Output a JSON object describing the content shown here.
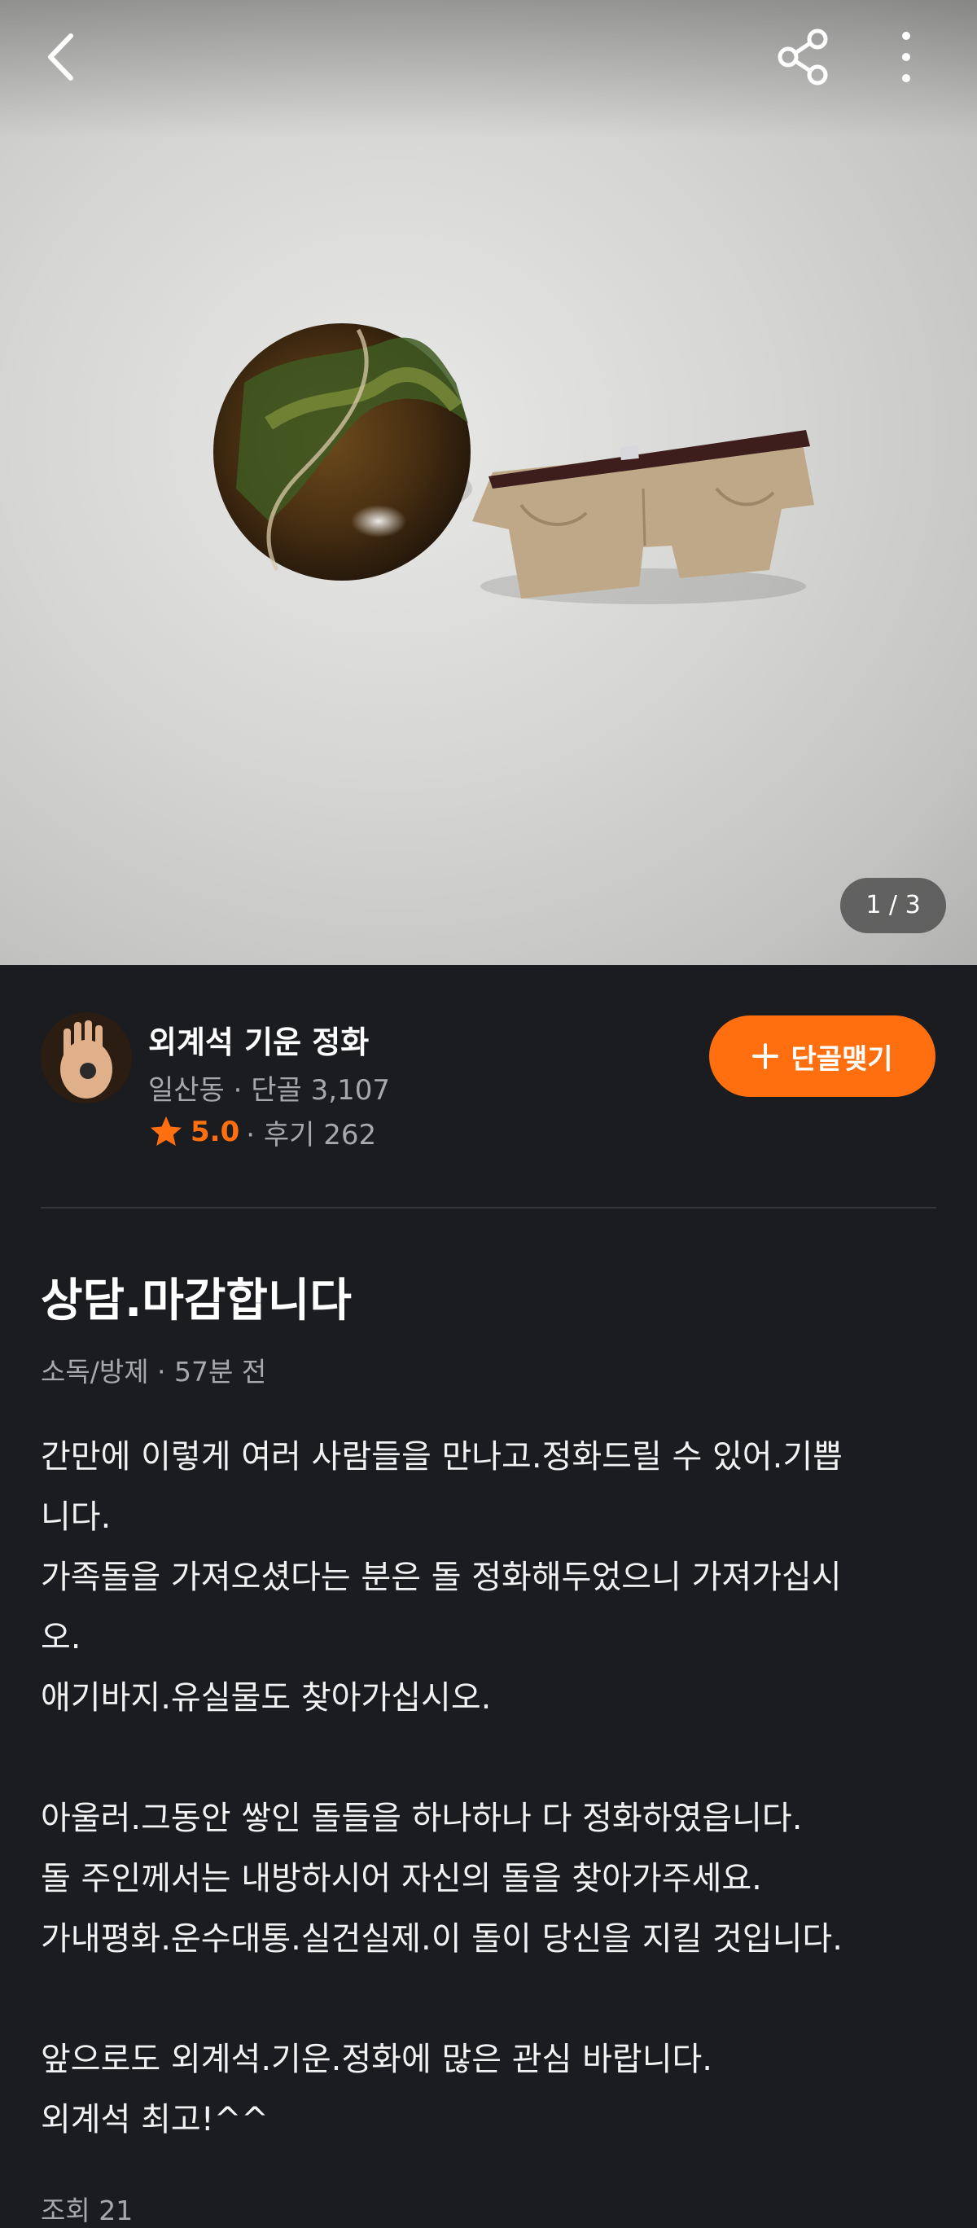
{
  "header": {
    "back_icon": "chevron-left-icon",
    "share_icon": "share-icon",
    "more_icon": "more-vertical-icon"
  },
  "gallery": {
    "indicator": "1 / 3"
  },
  "seller": {
    "name": "외계석 기운 정화",
    "meta": "일산동 · 단골 3,107",
    "rating": "5.0",
    "reviews": "· 후기 262",
    "follow_label": "단골맺기",
    "accent": "#ff6f0f"
  },
  "post": {
    "title": "상담.마감합니다",
    "meta": "소독/방제 · 57분 전",
    "lines": [
      "간만에 이렇게 여러 사람들을 만나고.정화드릴 수 있어.기쁩",
      "니다.",
      "가족돌을 가져오셨다는 분은 돌 정화해두었으니 가져가십시",
      "오.",
      "애기바지.유실물도 찾아가십시오.",
      "",
      "아울러.그동안 쌓인 돌들을 하나하나 다 정화하였읍니다.",
      "돌 주인께서는 내방하시어 자신의 돌을 찾아가주세요.",
      "가내평화.운수대통.실건실제.이 돌이 당신을 지킬 것입니다.",
      "",
      "앞으로도 외계석.기운.정화에 많은 관심 바랍니다.",
      "외계석 최고!^^"
    ],
    "views": "조회 21"
  }
}
